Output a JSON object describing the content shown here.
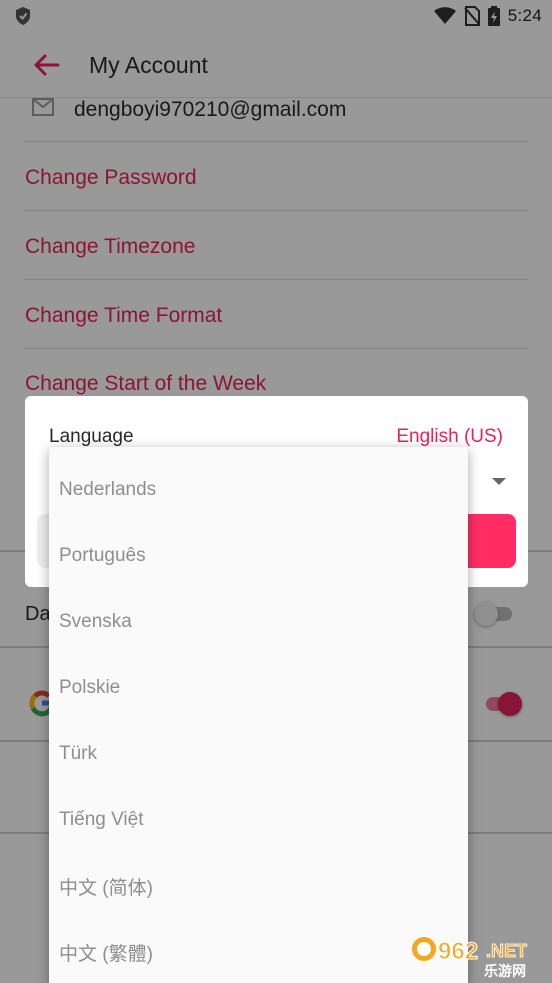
{
  "status_bar": {
    "time": "5:24",
    "icons": [
      "shield-icon",
      "wifi-icon",
      "no-sim-icon",
      "battery-charging-icon"
    ]
  },
  "app_bar": {
    "title": "My Account",
    "back_icon": "arrow-left-icon"
  },
  "account": {
    "email": "dengboyi970210@gmail.com",
    "email_icon": "mail-icon",
    "links": [
      "Change Password",
      "Change Timezone",
      "Change Time Format",
      "Change Start of the Week"
    ]
  },
  "settings": {
    "dark_mode_label_partial": "Da",
    "dark_mode_enabled": false,
    "google_linked": true
  },
  "dialog": {
    "language_label": "Language",
    "language_value": "English (US)"
  },
  "dropdown": {
    "options": [
      "Nederlands",
      "Português",
      "Svenska",
      "Polskie",
      "Türk",
      "Tiếng Việt",
      "中文 (简体)",
      "中文 (繁體)"
    ]
  },
  "watermark": {
    "brand_number": "962",
    "brand_suffix": ".NET",
    "brand_cn": "乐游网"
  },
  "colors": {
    "accent": "#e4245a",
    "primary_button": "#ff2d63",
    "scrim": "rgba(0,0,0,0.40)",
    "toggle_on": "#e4245a"
  }
}
